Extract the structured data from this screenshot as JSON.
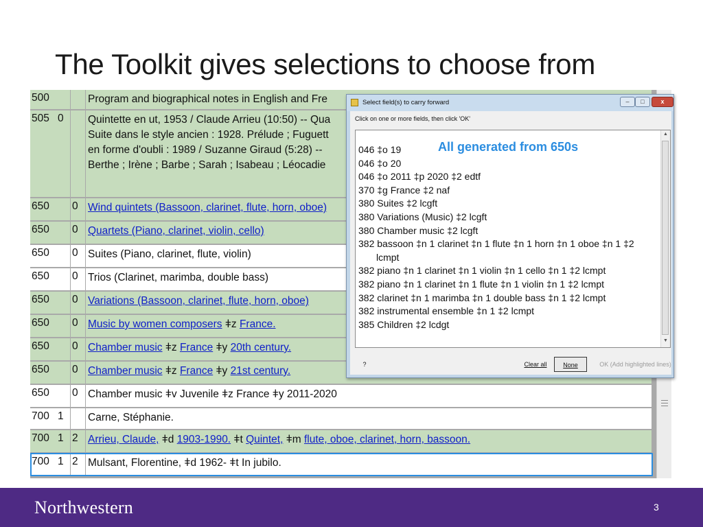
{
  "slide": {
    "title": "The Toolkit gives selections to choose from",
    "page_number": "3",
    "footer_brand": "Northwestern"
  },
  "record": {
    "rows": [
      {
        "tag": "500",
        "ind1": "",
        "ind2": "",
        "style": "green",
        "parts": [
          {
            "t": "Program and biographical notes in English and Fre",
            "link": false
          }
        ]
      },
      {
        "tag": "505",
        "ind1": "0",
        "ind2": "",
        "style": "green",
        "lines": [
          "Quintette en ut, 1953 / Claude Arrieu (10:50) -- Qua",
          "Suite dans le style ancien : 1928. Prélude ; Fuguett",
          "en forme d'oubli : 1989 / Suzanne Giraud (5:28) -- ",
          "Berthe ; Irène ; Barbe ; Sarah ; Isabeau ; Léocadie"
        ]
      },
      {
        "tag": "650",
        "ind1": "",
        "ind2": "0",
        "style": "green",
        "parts": [
          {
            "t": "Wind quintets (Bassoon, clarinet, flute, horn, oboe)",
            "link": true
          }
        ]
      },
      {
        "tag": "650",
        "ind1": "",
        "ind2": "0",
        "style": "green",
        "parts": [
          {
            "t": "Quartets (Piano, clarinet, violin, cello)",
            "link": true
          }
        ]
      },
      {
        "tag": "650",
        "ind1": "",
        "ind2": "0",
        "style": "white",
        "parts": [
          {
            "t": "Suites (Piano, clarinet, flute, violin)",
            "link": false
          }
        ]
      },
      {
        "tag": "650",
        "ind1": "",
        "ind2": "0",
        "style": "white",
        "parts": [
          {
            "t": "Trios (Clarinet, marimba, double bass)",
            "link": false
          }
        ]
      },
      {
        "tag": "650",
        "ind1": "",
        "ind2": "0",
        "style": "green",
        "parts": [
          {
            "t": "Variations (Bassoon, clarinet, flute, horn, oboe)",
            "link": true
          }
        ]
      },
      {
        "tag": "650",
        "ind1": "",
        "ind2": "0",
        "style": "green",
        "parts": [
          {
            "t": "Music by women composers",
            "link": true
          },
          {
            "t": " ǂz ",
            "link": false
          },
          {
            "t": "France.",
            "link": true
          }
        ]
      },
      {
        "tag": "650",
        "ind1": "",
        "ind2": "0",
        "style": "green",
        "parts": [
          {
            "t": "Chamber music",
            "link": true
          },
          {
            "t": " ǂz ",
            "link": false
          },
          {
            "t": "France",
            "link": true
          },
          {
            "t": " ǂy ",
            "link": false
          },
          {
            "t": "20th century.",
            "link": true
          }
        ]
      },
      {
        "tag": "650",
        "ind1": "",
        "ind2": "0",
        "style": "green",
        "parts": [
          {
            "t": "Chamber music",
            "link": true
          },
          {
            "t": " ǂz ",
            "link": false
          },
          {
            "t": "France",
            "link": true
          },
          {
            "t": " ǂy ",
            "link": false
          },
          {
            "t": "21st century.",
            "link": true
          }
        ]
      },
      {
        "tag": "650",
        "ind1": "",
        "ind2": "0",
        "style": "white",
        "parts": [
          {
            "t": "Chamber music ǂv Juvenile ǂz France ǂy 2011-2020",
            "link": false
          }
        ]
      },
      {
        "tag": "700",
        "ind1": "1",
        "ind2": "",
        "style": "white",
        "parts": [
          {
            "t": "Carne, Stéphanie.",
            "link": false
          }
        ]
      },
      {
        "tag": "700",
        "ind1": "1",
        "ind2": "2",
        "style": "green",
        "parts": [
          {
            "t": "Arrieu, Claude,",
            "link": true
          },
          {
            "t": " ǂd ",
            "link": false
          },
          {
            "t": "1903-1990.",
            "link": true
          },
          {
            "t": " ǂt ",
            "link": false
          },
          {
            "t": "Quintet,",
            "link": true
          },
          {
            "t": " ǂm ",
            "link": false
          },
          {
            "t": "flute, oboe, clarinet, horn, bassoon.",
            "link": true
          }
        ]
      },
      {
        "tag": "700",
        "ind1": "1",
        "ind2": "2",
        "style": "white",
        "selected": true,
        "parts": [
          {
            "t": "Mulsant, Florentine, ǂd 1962- ǂt In jubilo.",
            "link": false
          }
        ]
      }
    ]
  },
  "dialog": {
    "title": "Select field(s) to carry forward",
    "instruction": "Click on one or more fields, then click 'OK'",
    "annotation": "All generated from 650s",
    "items": [
      "046 ‡o 19",
      "046 ‡o 20",
      "046 ‡o 2011 ‡p 2020 ‡2 edtf",
      "370 ‡g France ‡2 naf",
      "380 Suites ‡2 lcgft",
      "380 Variations (Music) ‡2 lcgft",
      "380 Chamber music ‡2 lcgft",
      "382 bassoon ‡n 1 clarinet ‡n 1 flute ‡n 1 horn ‡n 1 oboe ‡n 1 ‡2",
      "lcmpt",
      "382 piano ‡n 1 clarinet ‡n 1 violin ‡n 1 cello ‡n 1 ‡2 lcmpt",
      "382 piano ‡n 1 clarinet ‡n 1 flute ‡n 1 violin ‡n 1 ‡2 lcmpt",
      "382 clarinet ‡n 1 marimba ‡n 1 double bass ‡n 1 ‡2 lcmpt",
      "382 instrumental ensemble ‡n 1 ‡2 lcmpt",
      "385 Children ‡2 lcdgt"
    ],
    "buttons": {
      "help": "?",
      "clear": "Clear all",
      "none": "None",
      "ok": "OK (Add highlighted lines)"
    },
    "window_controls": {
      "minimize": "–",
      "maximize": "□",
      "close": "x"
    }
  }
}
